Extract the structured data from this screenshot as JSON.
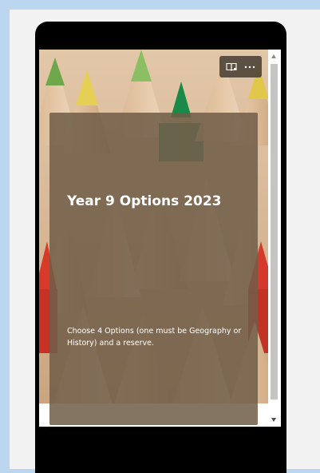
{
  "form": {
    "title": "Year 9 Options 2023",
    "description": "Choose 4 Options (one must be Geography or History) and a reserve."
  },
  "toolbar": {
    "buttons": [
      {
        "icon": "immersive-reader-icon"
      },
      {
        "icon": "more-options-icon"
      }
    ]
  },
  "colors": {
    "page_background": "#bcd6ef",
    "panel_background": "#f2f2f2",
    "device_frame": "#000000",
    "card_overlay": "#705d48",
    "card_text": "#ffffff"
  }
}
